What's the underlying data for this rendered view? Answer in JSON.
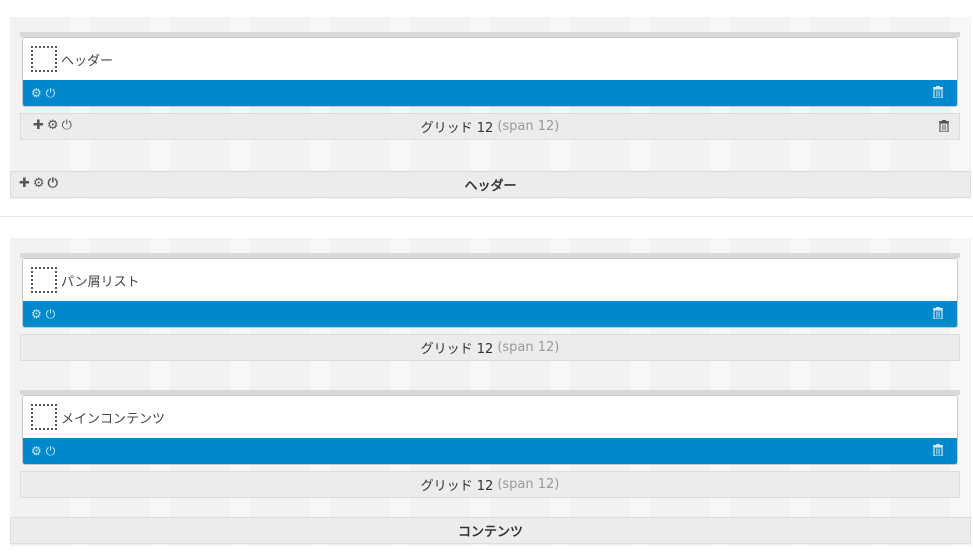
{
  "sections": [
    {
      "title": "ヘッダー",
      "grids": [
        {
          "label": "グリッド 12",
          "span": "(span 12)",
          "modules": [
            {
              "title": "ヘッダー"
            }
          ]
        }
      ]
    },
    {
      "title": "コンテンツ",
      "grids": [
        {
          "label": "グリッド 12",
          "span": "(span 12)",
          "modules": [
            {
              "title": "パン屑リスト"
            }
          ]
        },
        {
          "label": "グリッド 12",
          "span": "(span 12)",
          "modules": [
            {
              "title": "メインコンテンツ"
            }
          ]
        }
      ]
    }
  ],
  "icons": {
    "add": "plus-icon",
    "settings": "gear-icon",
    "toggle": "power-icon",
    "delete": "trash-icon"
  },
  "colors": {
    "module_bar": "#0088cc",
    "section_bg": "#f2f2f2",
    "bar_bg": "#ececec"
  }
}
